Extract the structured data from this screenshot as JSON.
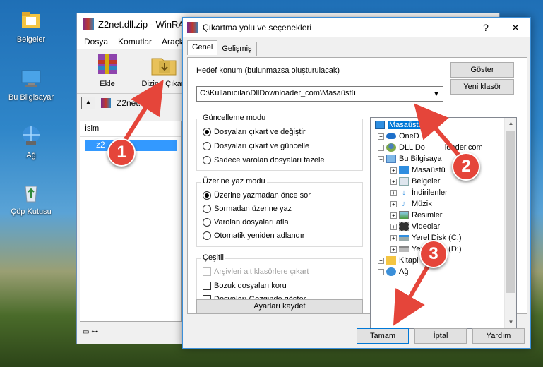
{
  "desktop": {
    "icons": [
      {
        "label": "Belgeler",
        "icon": "folder-icon"
      },
      {
        "label": "Bu Bilgisayar",
        "icon": "computer-icon"
      },
      {
        "label": "Ağ",
        "icon": "network-icon"
      },
      {
        "label": "Çöp Kutusu",
        "icon": "recycle-bin-icon"
      }
    ]
  },
  "winrar": {
    "title": "Z2net.dll.zip - WinRA",
    "menu": [
      "Dosya",
      "Komutlar",
      "Araçla"
    ],
    "tools": {
      "add_label": "Ekle",
      "extract_label": "Dizine Çıkart"
    },
    "address": "Z2net.dll.zi",
    "column_name": "İsim",
    "selected_row": "z2"
  },
  "dialog": {
    "title": "Çıkartma yolu ve seçenekleri",
    "help_glyph": "?",
    "close_glyph": "✕",
    "tabs": [
      "Genel",
      "Gelişmiş"
    ],
    "dest_label": "Hedef konum (bulunmazsa oluşturulacak)",
    "dest_value": "C:\\Kullanıcılar\\DllDownloader_com\\Masaüstü",
    "show_button": "Göster",
    "new_folder_button": "Yeni klasör",
    "update_group": {
      "title": "Güncelleme modu",
      "options": [
        "Dosyaları çıkart ve değiştir",
        "Dosyaları çıkart ve güncelle",
        "Sadece varolan dosyaları tazele"
      ],
      "selected": 0
    },
    "overwrite_group": {
      "title": "Üzerine yaz modu",
      "options": [
        "Üzerine yazmadan önce sor",
        "Sormadan üzerine yaz",
        "Varolan dosyaları atla",
        "Otomatik yeniden adlandır"
      ],
      "selected": 0
    },
    "misc_group": {
      "title": "Çeşitli",
      "options": [
        "Arşivleri alt klasörlere çıkart",
        "Bozuk dosyaları koru",
        "Dosyaları Gezginde göster"
      ]
    },
    "save_settings": "Ayarları kaydet",
    "tree": [
      {
        "label": "Masaüstü",
        "icon": "desktop-icon",
        "selected": true
      },
      {
        "label": "OneD",
        "icon": "onedrive-icon"
      },
      {
        "label": "DLL Do",
        "icon": "user-icon"
      },
      {
        "label": "Bu Bilgisaya",
        "icon": "computer-icon"
      },
      {
        "label": "Masaüstü",
        "icon": "desktop-icon"
      },
      {
        "label": "Belgeler",
        "icon": "documents-icon"
      },
      {
        "label": "İndirilenler",
        "icon": "downloads-icon"
      },
      {
        "label": "Müzik",
        "icon": "music-icon"
      },
      {
        "label": "Resimler",
        "icon": "pictures-icon"
      },
      {
        "label": "Videolar",
        "icon": "videos-icon"
      },
      {
        "label": "Yerel Disk (C:)",
        "icon": "drive-icon"
      },
      {
        "label": "Yerel Disk (D:)",
        "icon": "drive-icon"
      },
      {
        "label": "Kitapl",
        "icon": "libraries-icon"
      },
      {
        "label": "Ağ",
        "icon": "network-icon"
      }
    ],
    "tree_partial": {
      "dll_tail": "loader.com"
    },
    "ok_button": "Tamam",
    "cancel_button": "İptal",
    "help_button": "Yardım"
  },
  "callouts": [
    "1",
    "2",
    "3"
  ],
  "colors": {
    "callout": "#e5453a",
    "selection": "#0078d7"
  }
}
